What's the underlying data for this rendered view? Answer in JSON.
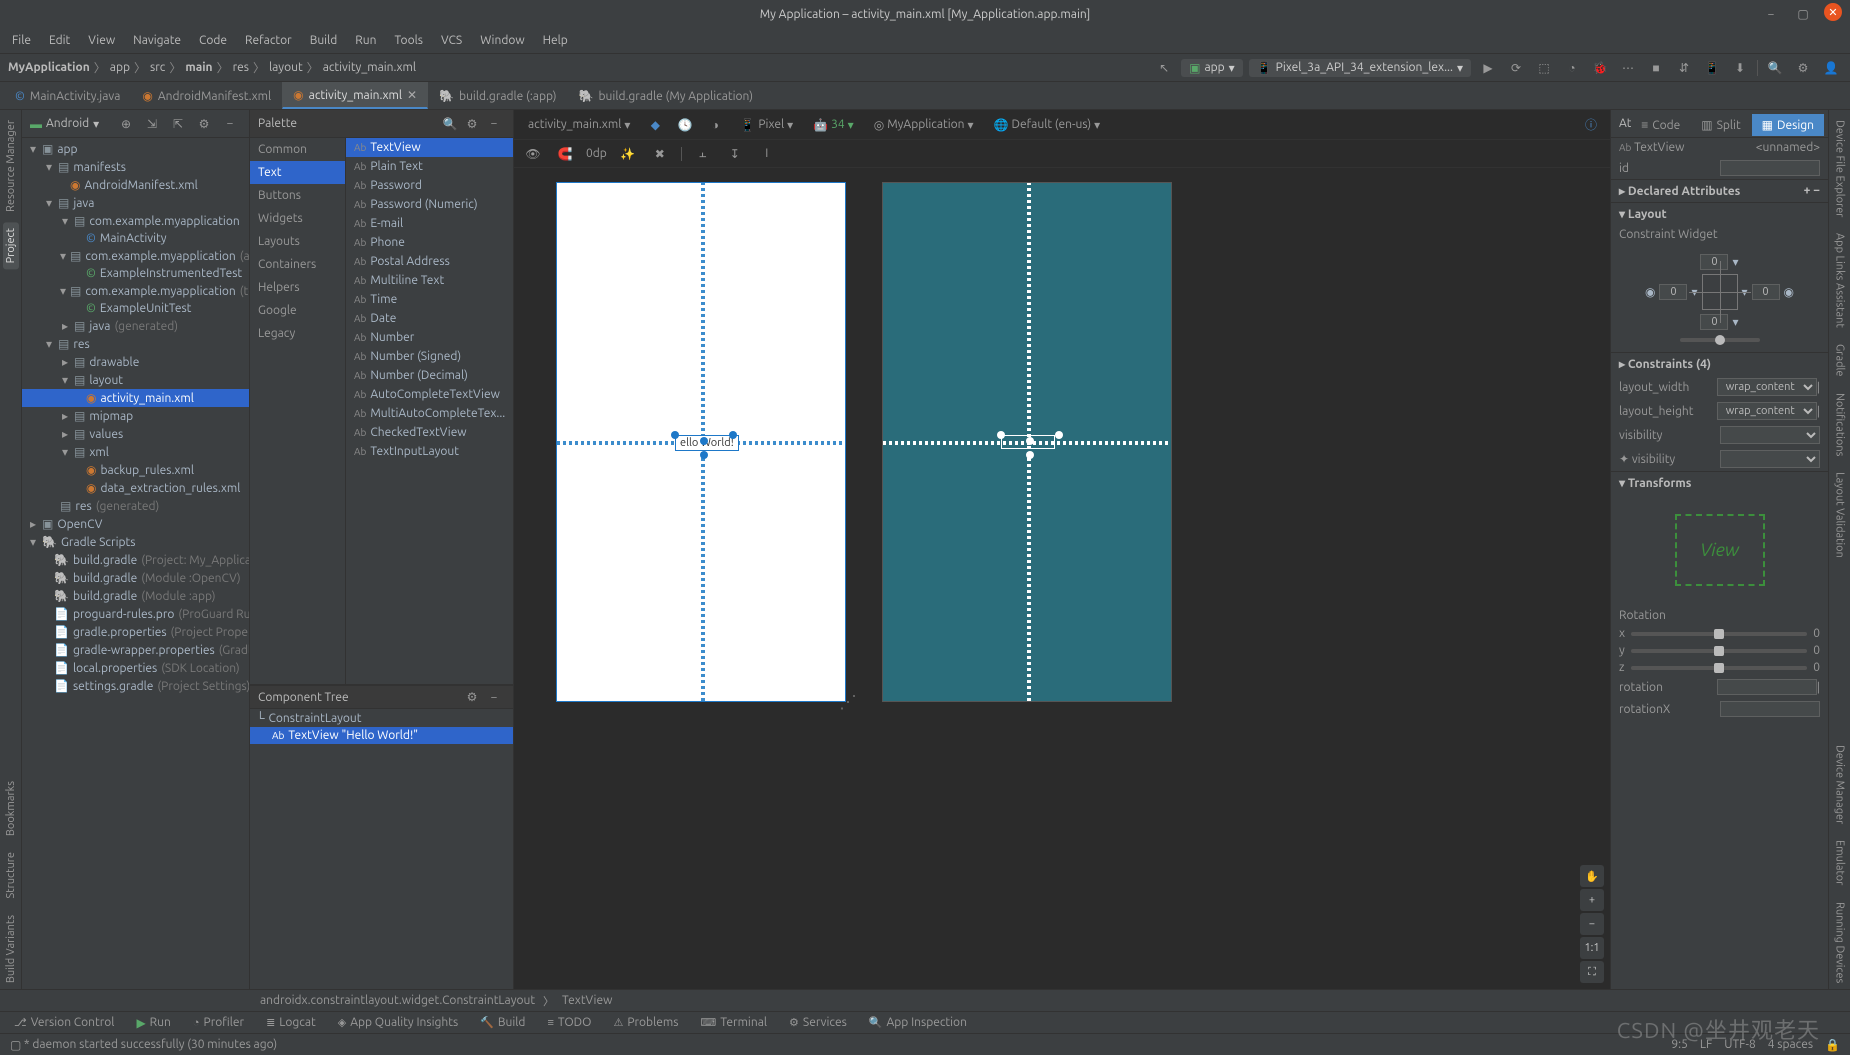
{
  "title": "My Application – activity_main.xml [My_Application.app.main]",
  "menu": [
    "File",
    "Edit",
    "View",
    "Navigate",
    "Code",
    "Refactor",
    "Build",
    "Run",
    "Tools",
    "VCS",
    "Window",
    "Help"
  ],
  "breadcrumbs": [
    "MyApplication",
    "app",
    "src",
    "main",
    "res",
    "layout",
    "activity_main.xml"
  ],
  "runconfig": {
    "module": "app",
    "device": "Pixel_3a_API_34_extension_lex..."
  },
  "editorTabs": [
    {
      "label": "MainActivity.java",
      "active": false
    },
    {
      "label": "AndroidManifest.xml",
      "active": false
    },
    {
      "label": "activity_main.xml",
      "active": true
    },
    {
      "label": "build.gradle (:app)",
      "active": false
    },
    {
      "label": "build.gradle (My Application)",
      "active": false
    }
  ],
  "viewModes": {
    "code": "Code",
    "split": "Split",
    "design": "Design"
  },
  "leftStripe": [
    "Resource Manager",
    "Project",
    "Bookmarks",
    "Structure",
    "Build Variants"
  ],
  "rightStripe": [
    "Device File Explorer",
    "App Links Assistant",
    "Gradle",
    "Notifications",
    "Layout Validation",
    "Device Manager",
    "Emulator",
    "Running Devices"
  ],
  "projectPanel": {
    "title": "Android",
    "tree": {
      "app": "app",
      "manifests": "manifests",
      "androidmanifest": "AndroidManifest.xml",
      "java": "java",
      "pkg1": "com.example.myapplication",
      "mainactivity": "MainActivity",
      "pkg2": "com.example.myapplication",
      "pkg2_suffix": "(an",
      "instrtest": "ExampleInstrumentedTest",
      "pkg3": "com.example.myapplication",
      "pkg3_suffix": "(te",
      "unittest": "ExampleUnitTest",
      "javagen": "java",
      "javagen_suffix": "(generated)",
      "res": "res",
      "drawable": "drawable",
      "layout": "layout",
      "activitymain": "activity_main.xml",
      "mipmap": "mipmap",
      "values": "values",
      "xml": "xml",
      "backup": "backup_rules.xml",
      "dataext": "data_extraction_rules.xml",
      "resgen": "res",
      "resgen_suffix": "(generated)",
      "opencv": "OpenCV",
      "gradlescripts": "Gradle Scripts",
      "bg1": "build.gradle",
      "bg1_suffix": "(Project: My_Applicati",
      "bg2": "build.gradle",
      "bg2_suffix": "(Module :OpenCV)",
      "bg3": "build.gradle",
      "bg3_suffix": "(Module :app)",
      "proguard": "proguard-rules.pro",
      "proguard_suffix": "(ProGuard Rule",
      "gprops": "gradle.properties",
      "gprops_suffix": "(Project Propert",
      "gwrapper": "gradle-wrapper.properties",
      "gwrapper_suffix": "(Gradle",
      "local": "local.properties",
      "local_suffix": "(SDK Location)",
      "settings": "settings.gradle",
      "settings_suffix": "(Project Settings)"
    }
  },
  "palette": {
    "title": "Palette",
    "categories": [
      "Common",
      "Text",
      "Buttons",
      "Widgets",
      "Layouts",
      "Containers",
      "Helpers",
      "Google",
      "Legacy"
    ],
    "activeCategory": "Text",
    "items": [
      "TextView",
      "Plain Text",
      "Password",
      "Password (Numeric)",
      "E-mail",
      "Phone",
      "Postal Address",
      "Multiline Text",
      "Time",
      "Date",
      "Number",
      "Number (Signed)",
      "Number (Decimal)",
      "AutoCompleteTextView",
      "MultiAutoCompleteTex...",
      "CheckedTextView",
      "TextInputLayout"
    ]
  },
  "componentTree": {
    "title": "Component Tree",
    "root": "ConstraintLayout",
    "child": "TextView \"Hello World!\""
  },
  "designToolbar": {
    "file": "activity_main.xml",
    "pixel": "Pixel",
    "api": "34",
    "app": "MyApplication",
    "locale": "Default (en-us)"
  },
  "subToolbar": {
    "dp": "0dp"
  },
  "designPreview": {
    "text": "ello World!"
  },
  "zoom": {
    "hand": "✋",
    "plus": "+",
    "minus": "−",
    "fit": "1:1",
    "full": "⛶"
  },
  "attributes": {
    "title": "Attributes",
    "type": "TextView",
    "unnamed": "<unnamed>",
    "id_label": "id",
    "declared": "Declared Attributes",
    "layout": "Layout",
    "constraintWidget": "Constraint Widget",
    "constraintVals": {
      "top": "0",
      "left": "0",
      "right": "0",
      "bottom": "0"
    },
    "constraints": "Constraints",
    "constraints_count": "(4)",
    "layout_width": "layout_width",
    "layout_width_val": "wrap_content",
    "layout_height": "layout_height",
    "layout_height_val": "wrap_content",
    "visibility": "visibility",
    "visibility2": "visibility",
    "transforms": "Transforms",
    "viewLabel": "View",
    "rotation": "Rotation",
    "axes": [
      "x",
      "y",
      "z"
    ],
    "axval": "0",
    "rotation2": "rotation",
    "rotationX": "rotationX"
  },
  "breadcrumb2": {
    "a": "androidx.constraintlayout.widget.ConstraintLayout",
    "b": "TextView"
  },
  "bottomTabs": [
    "Version Control",
    "Run",
    "Profiler",
    "Logcat",
    "App Quality Insights",
    "Build",
    "TODO",
    "Problems",
    "Terminal",
    "Services",
    "App Inspection"
  ],
  "statusbar": {
    "msg": "* daemon started successfully (30 minutes ago)",
    "pos": "9:5",
    "le": "LF",
    "enc": "UTF-8",
    "indent": "4 spaces"
  },
  "watermark": "CSDN @坐井观老天"
}
